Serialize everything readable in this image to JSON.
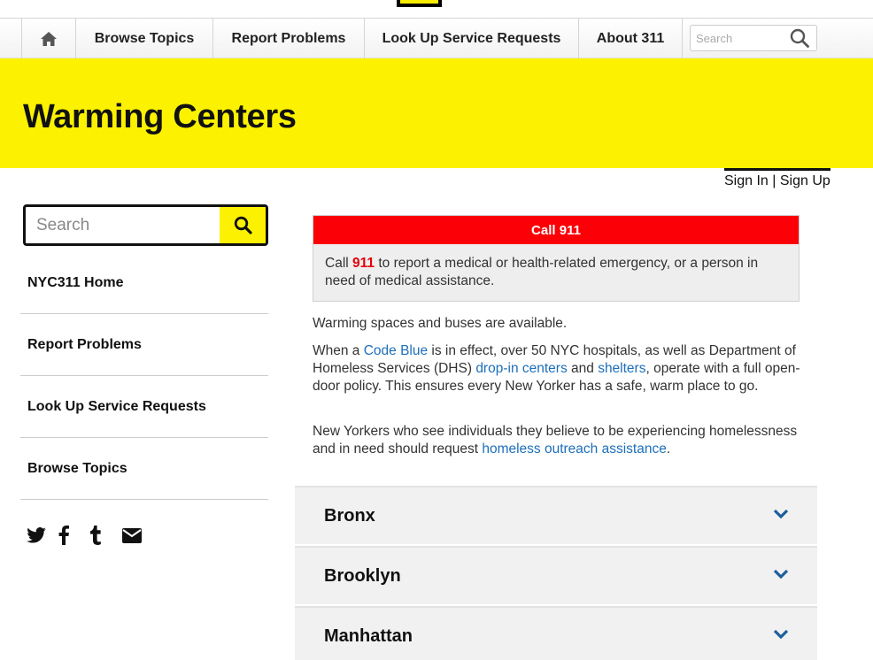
{
  "nav": {
    "home_icon": "home-icon",
    "items": [
      "Browse Topics",
      "Report Problems",
      "Look Up Service Requests",
      "About 311"
    ],
    "search_placeholder": "Search"
  },
  "banner": {
    "title": "Warming Centers",
    "color": "#fcf200"
  },
  "account": {
    "sign_in": "Sign In",
    "separator": " | ",
    "sign_up": "Sign Up"
  },
  "sidebar": {
    "search_placeholder": "Search",
    "items": [
      "NYC311 Home",
      "Report Problems",
      "Look Up Service Requests",
      "Browse Topics"
    ],
    "social_icons": [
      "twitter-icon",
      "facebook-icon",
      "tumblr-icon",
      "email-icon"
    ]
  },
  "alert": {
    "heading": "Call 911",
    "prefix": "Call ",
    "number": "911",
    "suffix": " to report a medical or health-related emergency, or a person in need of medical assistance.",
    "color": "#fb0007"
  },
  "content": {
    "p1": "Warming spaces and buses are available.",
    "p2": {
      "t1": "When a ",
      "link1": "Code Blue",
      "t2": " is in effect, over 50 NYC hospitals, as well as Department of Homeless Services (DHS) ",
      "link2": "drop-in centers",
      "t3": " and ",
      "link3": "shelters",
      "t4": ", operate with a full open-door policy. This ensures every New Yorker has a safe, warm place to go."
    },
    "p3": {
      "t1": "New Yorkers who see individuals they believe to be experiencing homelessness and in need should request ",
      "link1": "homeless outreach assistance",
      "t2": "."
    }
  },
  "accordion": [
    "Bronx",
    "Brooklyn",
    "Manhattan"
  ]
}
